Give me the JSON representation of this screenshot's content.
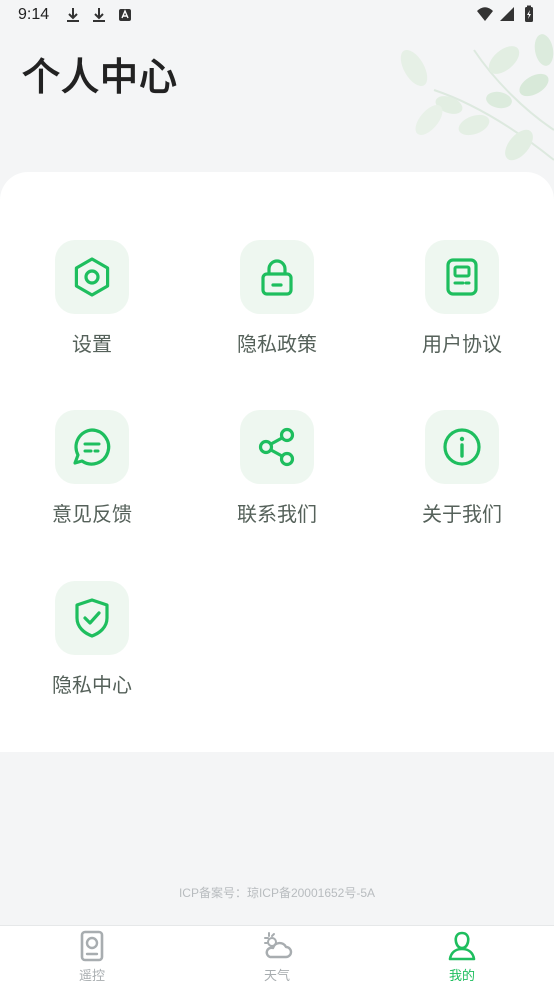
{
  "status_bar": {
    "time": "9:14"
  },
  "header": {
    "title": "个人中心"
  },
  "menu": {
    "items": [
      {
        "label": "设置",
        "icon": "hexagon-settings-icon"
      },
      {
        "label": "隐私政策",
        "icon": "lock-icon"
      },
      {
        "label": "用户协议",
        "icon": "document-icon"
      },
      {
        "label": "意见反馈",
        "icon": "chat-bubble-icon"
      },
      {
        "label": "联系我们",
        "icon": "share-icon"
      },
      {
        "label": "关于我们",
        "icon": "info-icon"
      },
      {
        "label": "隐私中心",
        "icon": "shield-check-icon"
      }
    ]
  },
  "footer": {
    "icp": "ICP备案号：琼ICP备20001652号-5A"
  },
  "tabbar": {
    "tabs": [
      {
        "label": "遥控",
        "icon": "remote-icon",
        "active": false
      },
      {
        "label": "天气",
        "icon": "weather-icon",
        "active": false
      },
      {
        "label": "我的",
        "icon": "profile-icon",
        "active": true
      }
    ]
  },
  "colors": {
    "accent": "#1ebe5e",
    "icon_bg": "#eef7f0",
    "page_bg": "#f4f5f6"
  }
}
